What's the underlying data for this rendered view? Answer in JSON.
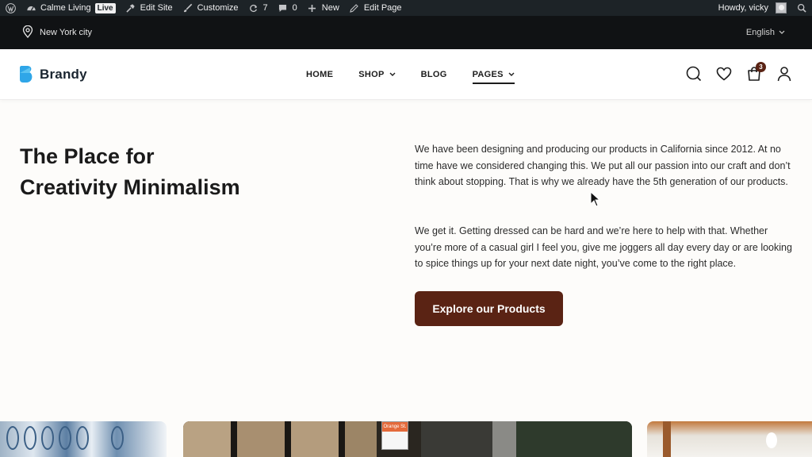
{
  "admin_bar": {
    "site_name": "Calme Living",
    "live_badge": "Live",
    "edit_site": "Edit Site",
    "customize": "Customize",
    "updates_count": "7",
    "comments_count": "0",
    "new": "New",
    "edit_page": "Edit Page",
    "greeting": "Howdy, vicky"
  },
  "topbar": {
    "location": "New York city",
    "language": "English"
  },
  "header": {
    "logo_text": "Brandy",
    "nav": {
      "home": "HOME",
      "shop": "SHOP",
      "blog": "BLOG",
      "pages": "PAGES"
    },
    "cart_count": "3"
  },
  "hero": {
    "title_line1": "The Place for",
    "title_line2": "Creativity Minimalism",
    "paragraph1": "We have been designing and producing our products in California since 2012. At no time have we considered changing this. We put all our passion into our craft and don’t think about stopping. That is why we already have the 5th generation of our products.",
    "paragraph2": "We get it. Getting dressed can be hard and we’re here to help with that. Whether you’re more of a casual girl I feel you, give me joggers all day every day or are looking to spice things up for your next date night, you’ve come to the right place.",
    "cta_label": "Explore our Products"
  },
  "colors": {
    "accent": "#5a2314",
    "admin_bar": "#1d2327",
    "topbar": "#101214",
    "logo": "#2fa6e8"
  },
  "gallery": {
    "sign_text": "Orange St."
  }
}
